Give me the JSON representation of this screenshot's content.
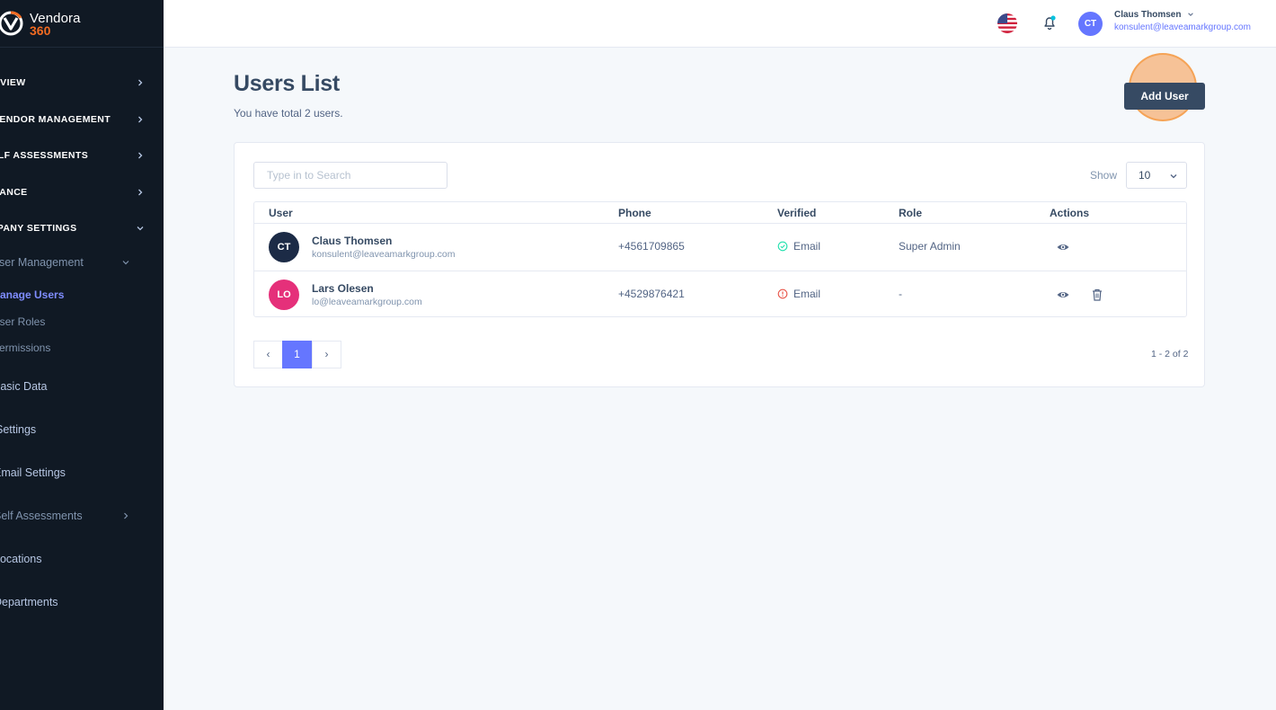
{
  "brand": {
    "name": "Vendora",
    "sub": "360"
  },
  "sidebar": {
    "sections": [
      {
        "label": "OVERVIEW"
      },
      {
        "label": "VENDOR MANAGEMENT"
      },
      {
        "label": "SELF ASSESSMENTS"
      },
      {
        "label": "COMPLIANCE"
      },
      {
        "label": "COMPANY SETTINGS"
      }
    ],
    "user_management": "User Management",
    "manage_users": "Manage Users",
    "user_roles": "User Roles",
    "permissions": "Permissions",
    "items": [
      "Basic Data",
      "Settings",
      "Email Settings",
      "Self Assessments",
      "Locations",
      "Departments"
    ]
  },
  "topbar": {
    "user_initials": "CT",
    "user_name": "Claus Thomsen",
    "user_email": "konsulent@leaveamarkgroup.com"
  },
  "page": {
    "title": "Users List",
    "subtitle": "You have total 2 users.",
    "add_button": "Add User"
  },
  "toolbar": {
    "search_placeholder": "Type in to Search",
    "show_label": "Show",
    "show_value": "10"
  },
  "table": {
    "headers": {
      "user": "User",
      "phone": "Phone",
      "verified": "Verified",
      "role": "Role",
      "actions": "Actions"
    },
    "rows": [
      {
        "initials": "CT",
        "avatar_color": "#1c2b46",
        "name": "Claus Thomsen",
        "email": "konsulent@leaveamarkgroup.com",
        "phone": "+4561709865",
        "verified": "Email",
        "verified_status": "verified",
        "role": "Super Admin"
      },
      {
        "initials": "LO",
        "avatar_color": "#e5307a",
        "name": "Lars Olesen",
        "email": "lo@leaveamarkgroup.com",
        "phone": "+4529876421",
        "verified": "Email",
        "verified_status": "unverified",
        "role": "-"
      }
    ]
  },
  "pagination": {
    "prev": "‹",
    "current": "1",
    "next": "›",
    "range": "1 - 2 of 2"
  },
  "colors": {
    "accent": "#6576ff",
    "sidebar_bg": "#101924",
    "verified": "#1ee0ac",
    "unverified": "#e85347",
    "click_highlight": "#f59646"
  }
}
